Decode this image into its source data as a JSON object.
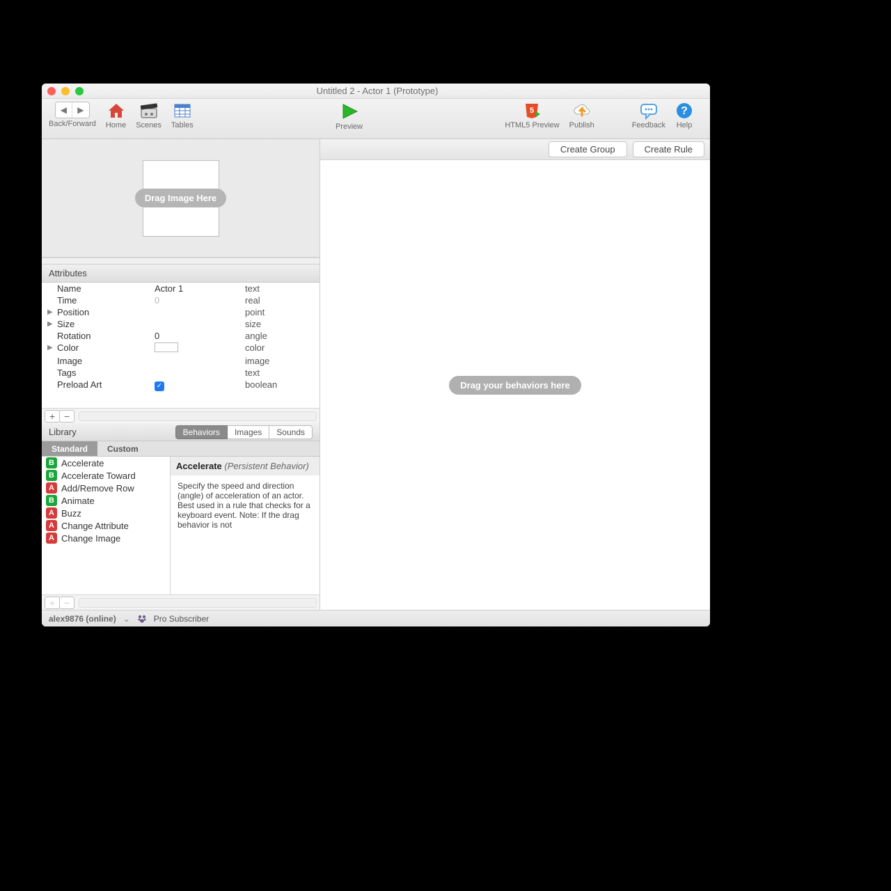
{
  "window": {
    "title": "Untitled 2 - Actor 1 (Prototype)"
  },
  "toolbar": {
    "back_forward": "Back/Forward",
    "home": "Home",
    "scenes": "Scenes",
    "tables": "Tables",
    "preview": "Preview",
    "html5_preview": "HTML5 Preview",
    "publish": "Publish",
    "feedback": "Feedback",
    "help": "Help"
  },
  "actor_image": {
    "placeholder": "Drag Image Here"
  },
  "attributes": {
    "header": "Attributes",
    "rows": [
      {
        "name": "Name",
        "value": "Actor 1",
        "type": "text",
        "expandable": false
      },
      {
        "name": "Time",
        "value": "0",
        "type": "real",
        "expandable": false,
        "dim": true
      },
      {
        "name": "Position",
        "value": "",
        "type": "point",
        "expandable": true
      },
      {
        "name": "Size",
        "value": "",
        "type": "size",
        "expandable": true
      },
      {
        "name": "Rotation",
        "value": "0",
        "type": "angle",
        "expandable": false
      },
      {
        "name": "Color",
        "value": "",
        "type": "color",
        "expandable": true,
        "swatch": true
      },
      {
        "name": "Image",
        "value": "",
        "type": "image",
        "expandable": false
      },
      {
        "name": "Tags",
        "value": "",
        "type": "text",
        "expandable": false
      },
      {
        "name": "Preload Art",
        "value": "",
        "type": "boolean",
        "expandable": false,
        "checked": true
      }
    ]
  },
  "library": {
    "header": "Library",
    "tabs": [
      "Behaviors",
      "Images",
      "Sounds"
    ],
    "active_tab": "Behaviors",
    "subtabs": [
      "Standard",
      "Custom"
    ],
    "active_subtab": "Standard",
    "items": [
      {
        "badge": "B",
        "label": "Accelerate"
      },
      {
        "badge": "B",
        "label": "Accelerate Toward"
      },
      {
        "badge": "A",
        "label": "Add/Remove Row"
      },
      {
        "badge": "B",
        "label": "Animate"
      },
      {
        "badge": "A",
        "label": "Buzz"
      },
      {
        "badge": "A",
        "label": "Change Attribute"
      },
      {
        "badge": "A",
        "label": "Change Image"
      }
    ],
    "description": {
      "title": "Accelerate",
      "subtitle": "(Persistent Behavior)",
      "body": "Specify the speed and direction (angle) of acceleration of an actor. Best used in a rule that checks for a keyboard event. Note: If the drag behavior is not"
    }
  },
  "right": {
    "create_group": "Create Group",
    "create_rule": "Create Rule",
    "drop_hint": "Drag your behaviors here"
  },
  "status": {
    "user": "alex9876 (online)",
    "tier": "Pro Subscriber"
  }
}
